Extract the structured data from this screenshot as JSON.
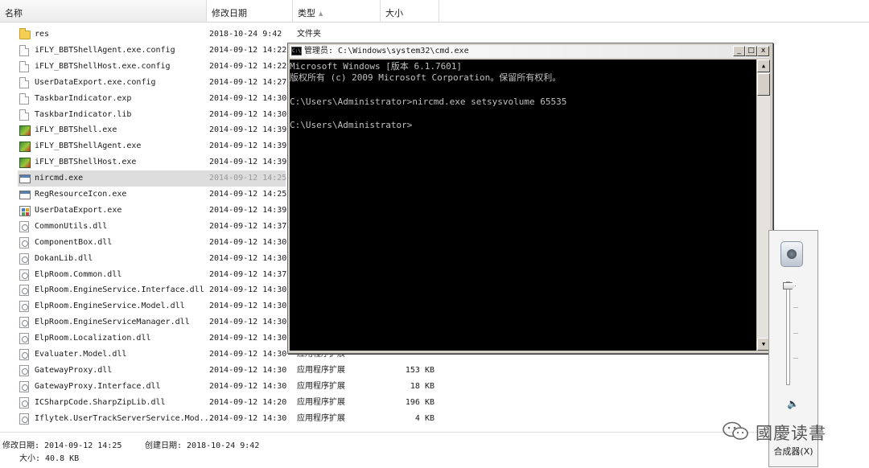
{
  "explorer": {
    "columns": [
      {
        "label": "名称"
      },
      {
        "label": "修改日期"
      },
      {
        "label": "类型"
      },
      {
        "label": "大小"
      }
    ],
    "files": [
      {
        "name": "res",
        "date": "2018-10-24 9:42",
        "type": "文件夹",
        "size": "",
        "icon": "folder-icon",
        "selected": false
      },
      {
        "name": "iFLY_BBTShellAgent.exe.config",
        "date": "2014-09-12 14:22",
        "type": "",
        "size": "",
        "icon": "file-icon",
        "selected": false
      },
      {
        "name": "iFLY_BBTShellHost.exe.config",
        "date": "2014-09-12 14:22",
        "type": "",
        "size": "",
        "icon": "file-icon",
        "selected": false
      },
      {
        "name": "UserDataExport.exe.config",
        "date": "2014-09-12 14:27",
        "type": "",
        "size": "",
        "icon": "file-icon",
        "selected": false
      },
      {
        "name": "TaskbarIndicator.exp",
        "date": "2014-09-12 14:30",
        "type": "",
        "size": "",
        "icon": "file-icon",
        "selected": false
      },
      {
        "name": "TaskbarIndicator.lib",
        "date": "2014-09-12 14:30",
        "type": "",
        "size": "",
        "icon": "file-icon",
        "selected": false
      },
      {
        "name": "iFLY_BBTShell.exe",
        "date": "2014-09-12 14:39",
        "type": "",
        "size": "",
        "icon": "exe-icon",
        "selected": false
      },
      {
        "name": "iFLY_BBTShellAgent.exe",
        "date": "2014-09-12 14:39",
        "type": "",
        "size": "",
        "icon": "exe-icon",
        "selected": false
      },
      {
        "name": "iFLY_BBTShellHost.exe",
        "date": "2014-09-12 14:39",
        "type": "",
        "size": "",
        "icon": "exe-icon",
        "selected": false
      },
      {
        "name": "nircmd.exe",
        "date": "2014-09-12 14:25",
        "type": "",
        "size": "",
        "icon": "app-icon",
        "selected": true
      },
      {
        "name": "RegResourceIcon.exe",
        "date": "2014-09-12 14:25",
        "type": "",
        "size": "",
        "icon": "app-icon",
        "selected": false
      },
      {
        "name": "UserDataExport.exe",
        "date": "2014-09-12 14:39",
        "type": "",
        "size": "",
        "icon": "reg-icon",
        "selected": false
      },
      {
        "name": "CommonUtils.dll",
        "date": "2014-09-12 14:37",
        "type": "",
        "size": "",
        "icon": "dll-icon",
        "selected": false
      },
      {
        "name": "ComponentBox.dll",
        "date": "2014-09-12 14:30",
        "type": "",
        "size": "",
        "icon": "dll-icon",
        "selected": false
      },
      {
        "name": "DokanLib.dll",
        "date": "2014-09-12 14:30",
        "type": "",
        "size": "",
        "icon": "dll-icon",
        "selected": false
      },
      {
        "name": "ElpRoom.Common.dll",
        "date": "2014-09-12 14:37",
        "type": "",
        "size": "",
        "icon": "dll-icon",
        "selected": false
      },
      {
        "name": "ElpRoom.EngineService.Interface.dll",
        "date": "2014-09-12 14:30",
        "type": "",
        "size": "",
        "icon": "dll-icon",
        "selected": false
      },
      {
        "name": "ElpRoom.EngineService.Model.dll",
        "date": "2014-09-12 14:30",
        "type": "",
        "size": "",
        "icon": "dll-icon",
        "selected": false
      },
      {
        "name": "ElpRoom.EngineServiceManager.dll",
        "date": "2014-09-12 14:30",
        "type": "",
        "size": "",
        "icon": "dll-icon",
        "selected": false
      },
      {
        "name": "ElpRoom.Localization.dll",
        "date": "2014-09-12 14:30",
        "type": "",
        "size": "",
        "icon": "dll-icon",
        "selected": false
      },
      {
        "name": "Evaluater.Model.dll",
        "date": "2014-09-12 14:30",
        "type": "应用程序扩展",
        "size": "",
        "icon": "dll-icon",
        "selected": false
      },
      {
        "name": "GatewayProxy.dll",
        "date": "2014-09-12 14:30",
        "type": "应用程序扩展",
        "size": "153 KB",
        "icon": "dll-icon",
        "selected": false
      },
      {
        "name": "GatewayProxy.Interface.dll",
        "date": "2014-09-12 14:30",
        "type": "应用程序扩展",
        "size": "18 KB",
        "icon": "dll-icon",
        "selected": false
      },
      {
        "name": "ICSharpCode.SharpZipLib.dll",
        "date": "2014-09-12 14:20",
        "type": "应用程序扩展",
        "size": "196 KB",
        "icon": "dll-icon",
        "selected": false
      },
      {
        "name": "Iflytek.UserTrackServerService.Mod...",
        "date": "2014-09-12 14:30",
        "type": "应用程序扩展",
        "size": "4 KB",
        "icon": "dll-icon",
        "selected": false
      }
    ]
  },
  "cmd": {
    "title": "管理员: C:\\Windows\\system32\\cmd.exe",
    "minimize_label": "_",
    "maximize_label": "□",
    "close_label": "x",
    "lines": [
      "Microsoft Windows [版本 6.1.7601]",
      "版权所有 (c) 2009 Microsoft Corporation。保留所有权利。",
      "",
      "C:\\Users\\Administrator>nircmd.exe setsysvolume 65535",
      "",
      "C:\\Users\\Administrator>"
    ]
  },
  "volume_popup": {
    "level_fraction": 1.0,
    "mixer_label": "合成器(X)",
    "speaker_icon": "speaker-icon",
    "mute_icon": "volume-icon"
  },
  "details": {
    "modified": "修改日期: 2014-09-12 14:25",
    "created": "创建日期: 2018-10-24 9:42",
    "size": "大小: 40.8 KB"
  },
  "watermark": {
    "text": "國慶读書"
  },
  "colors": {
    "console_bg": "#000000",
    "console_text": "#c0c0c0",
    "selection": "#dcdcdc"
  }
}
